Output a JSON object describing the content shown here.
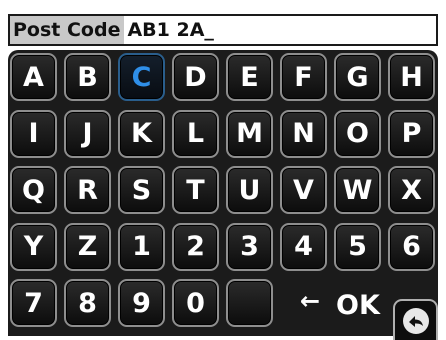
{
  "entry": {
    "label": "Post Code",
    "value": "AB1 2A_"
  },
  "keyboard": {
    "selected_key": "C",
    "rows": [
      [
        "A",
        "B",
        "C",
        "D",
        "E",
        "F",
        "G",
        "H"
      ],
      [
        "I",
        "J",
        "K",
        "L",
        "M",
        "N",
        "O",
        "P"
      ],
      [
        "Q",
        "R",
        "S",
        "T",
        "U",
        "V",
        "W",
        "X"
      ],
      [
        "Y",
        "Z",
        "1",
        "2",
        "3",
        "4",
        "5",
        "6"
      ],
      [
        "7",
        "8",
        "9",
        "0",
        ""
      ]
    ],
    "backspace_label": "←",
    "ok_label": "OK"
  },
  "colors": {
    "selected_key": "#2f8fe8",
    "key_border": "#8e8e8e",
    "keyboard_background": "#1b1b1b",
    "label_background": "#c8c8c8"
  },
  "icons": {
    "exit": "return-arrow-icon"
  }
}
